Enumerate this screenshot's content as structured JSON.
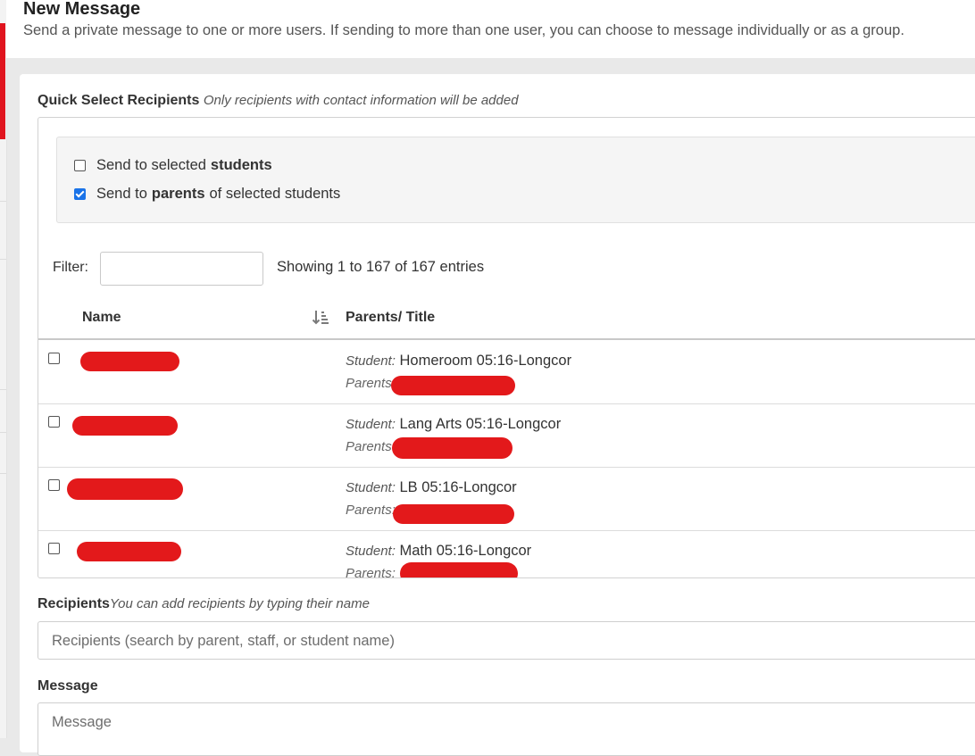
{
  "header": {
    "title": "New Message",
    "subtitle": "Send a private message to one or more users. If sending to more than one user, you can choose to message individually or as a group."
  },
  "quick_select": {
    "label": "Quick Select Recipients",
    "hint": "Only recipients with contact information will be added",
    "option_students": {
      "prefix": "Send to selected",
      "bold": "students",
      "suffix": "",
      "checked": false
    },
    "option_parents": {
      "prefix": "Send to",
      "bold": "parents",
      "suffix": "of selected students",
      "checked": true
    }
  },
  "table": {
    "filter_label": "Filter:",
    "filter_value": "",
    "showing_text": "Showing 1 to 167 of 167 entries",
    "columns": [
      "Name",
      "Parents/ Title"
    ],
    "rows": [
      {
        "student_label": "Student:",
        "course": "Homeroom 05:16-Longcor",
        "parents_label": "Parents",
        "name_redacted": true,
        "checked": false
      },
      {
        "student_label": "Student:",
        "course": "Lang Arts 05:16-Longcor",
        "parents_label": "Parents",
        "name_redacted": true,
        "checked": false
      },
      {
        "student_label": "Student:",
        "course": "LB 05:16-Longcor",
        "parents_label": "Parents:",
        "name_redacted": true,
        "checked": false
      },
      {
        "student_label": "Student:",
        "course": "Math 05:16-Longcor",
        "parents_label": "Parents:",
        "name_redacted": true,
        "checked": false
      }
    ]
  },
  "recipients": {
    "label": "Recipients",
    "hint": "You can add recipients by typing their name",
    "placeholder": "Recipients (search by parent, staff, or student name)"
  },
  "message": {
    "label": "Message",
    "placeholder": "Message"
  },
  "colors": {
    "brand_red": "#e0141e",
    "redaction": "#e3191b",
    "checkbox_checked": "#1a73e8"
  },
  "icons": {
    "sort": "sort-descending-icon"
  }
}
